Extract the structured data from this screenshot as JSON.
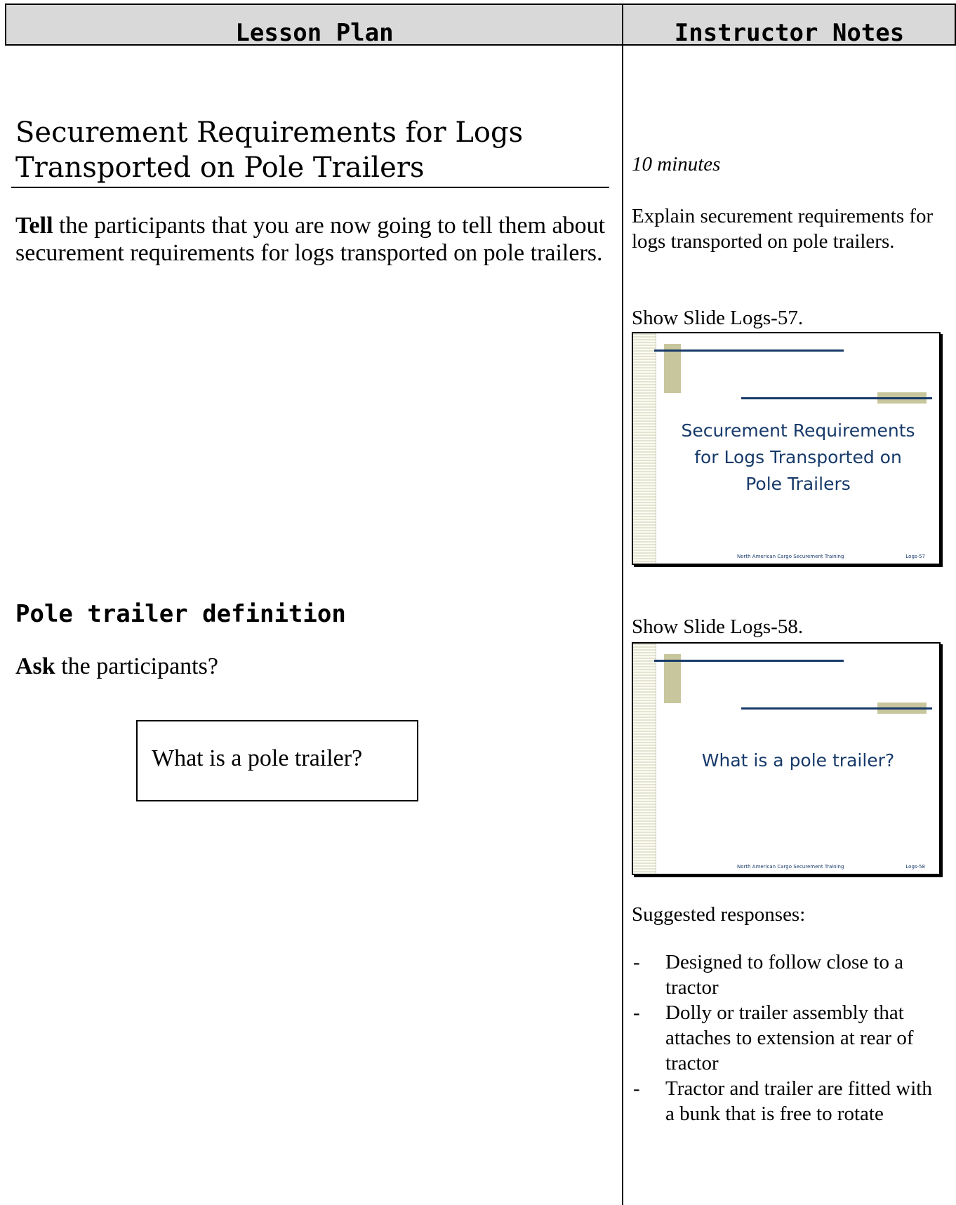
{
  "header": {
    "left_title": "Lesson Plan",
    "right_title": "Instructor Notes"
  },
  "lesson": {
    "section_title_line1": "Securement Requirements for Logs",
    "section_title_line2": "Transported on Pole Trailers",
    "tell_bold": "Tell",
    "tell_text": " the participants that you are now going to tell them about securement requirements for logs transported on pole trailers.",
    "subheading": "Pole trailer definition",
    "ask_bold": "Ask",
    "ask_text": " the participants?",
    "question": "What is a pole trailer?"
  },
  "notes": {
    "duration": "10 minutes",
    "explain": "Explain securement requirements for logs transported on pole trailers.",
    "show_slide_1": "Show Slide Logs-57.",
    "show_slide_2": "Show Slide Logs-58.",
    "suggested_label": "Suggested responses:",
    "responses": [
      "Designed to follow close to a tractor",
      "Dolly or trailer assembly that attaches to extension at rear of tractor",
      "Tractor and trailer are fitted with a bunk that is free to rotate"
    ],
    "dash": "-"
  },
  "slides": [
    {
      "title_lines": [
        "Securement Requirements",
        "for Logs Transported on",
        "Pole Trailers"
      ],
      "footer": "North American Cargo Securement Training",
      "slide_id": "Logs-57"
    },
    {
      "title_lines": [
        "What is a pole trailer?"
      ],
      "footer": "North American Cargo Securement Training",
      "slide_id": "Logs-58"
    }
  ],
  "colors": {
    "header_bg": "#d9d9d9",
    "slide_navy": "#173a6a",
    "slide_accent": "#c8c69c"
  }
}
